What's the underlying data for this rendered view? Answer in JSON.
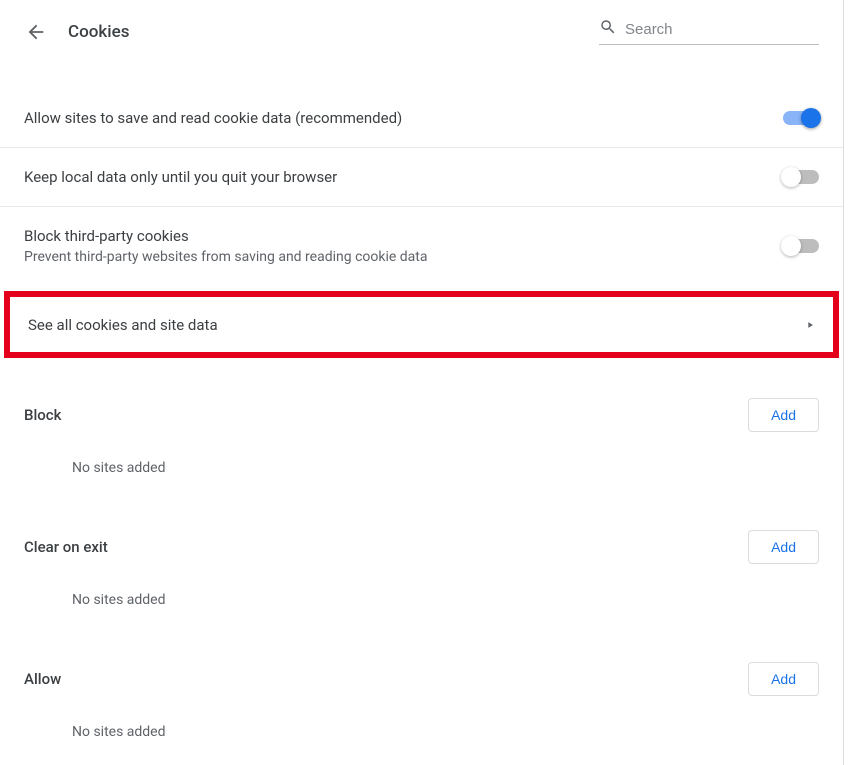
{
  "header": {
    "title": "Cookies",
    "search_placeholder": "Search"
  },
  "rows": {
    "allow_sites": {
      "title": "Allow sites to save and read cookie data (recommended)"
    },
    "keep_local": {
      "title": "Keep local data only until you quit your browser"
    },
    "block_third_party": {
      "title": "Block third-party cookies",
      "subtitle": "Prevent third-party websites from saving and reading cookie data"
    },
    "see_all": {
      "title": "See all cookies and site data"
    }
  },
  "sections": {
    "block": {
      "title": "Block",
      "add_label": "Add",
      "empty": "No sites added"
    },
    "clear_exit": {
      "title": "Clear on exit",
      "add_label": "Add",
      "empty": "No sites added"
    },
    "allow": {
      "title": "Allow",
      "add_label": "Add",
      "empty": "No sites added"
    }
  }
}
